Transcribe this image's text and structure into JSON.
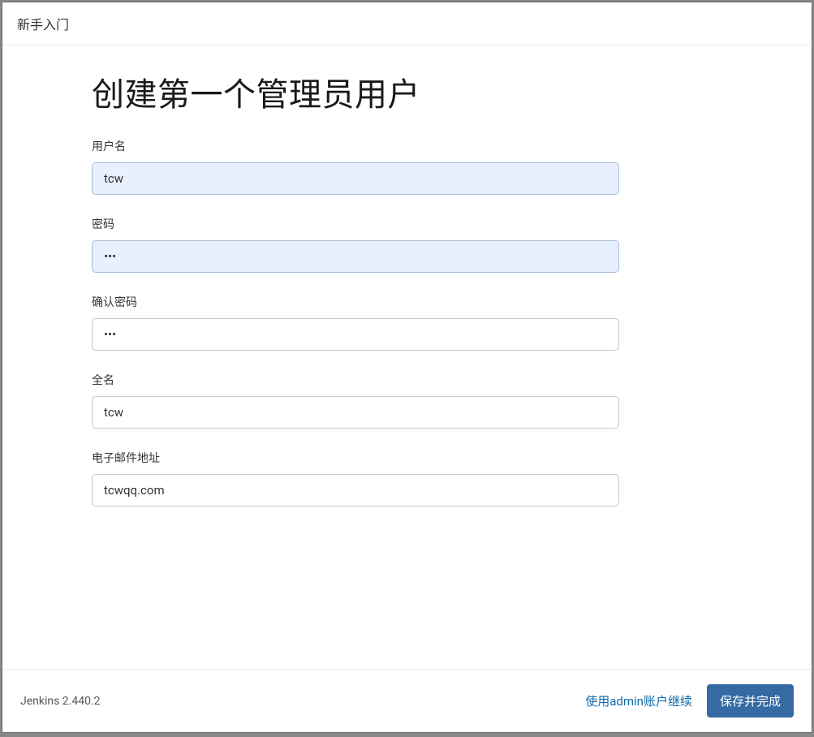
{
  "header": {
    "title": "新手入门"
  },
  "main": {
    "heading": "创建第一个管理员用户",
    "fields": {
      "username": {
        "label": "用户名",
        "value": "tcw"
      },
      "password": {
        "label": "密码",
        "value": "•••"
      },
      "confirm_password": {
        "label": "确认密码",
        "value": "•••"
      },
      "fullname": {
        "label": "全名",
        "value": "tcw"
      },
      "email": {
        "label": "电子邮件地址",
        "value": "tcwqq.com"
      }
    }
  },
  "footer": {
    "version": "Jenkins 2.440.2",
    "skip_label": "使用admin账户继续",
    "save_label": "保存并完成"
  }
}
